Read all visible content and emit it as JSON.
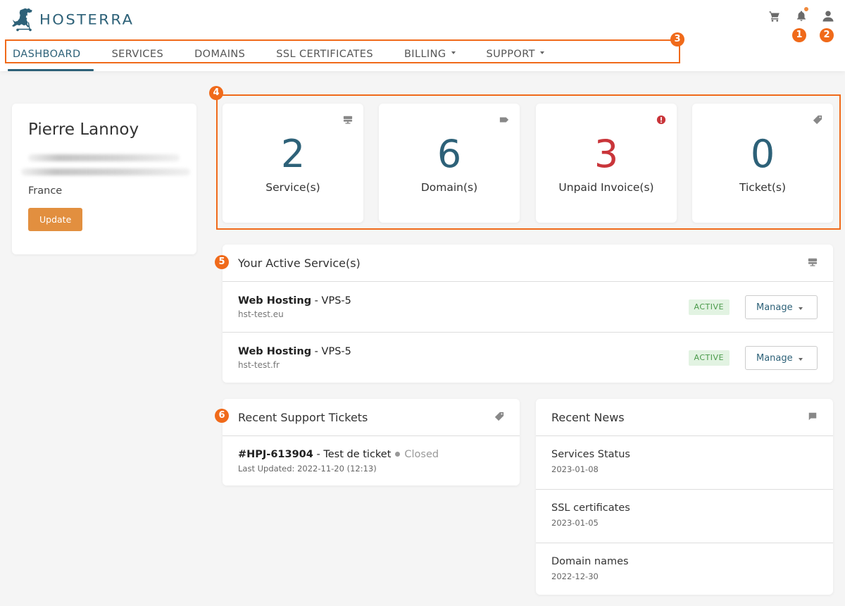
{
  "brand": {
    "name": "HOSTERRA",
    "color": "#2d6178"
  },
  "header": {
    "icons": [
      {
        "name": "cart-icon"
      },
      {
        "name": "bell-icon",
        "has_notification": true
      },
      {
        "name": "user-icon"
      }
    ]
  },
  "nav": {
    "items": [
      {
        "label": "DASHBOARD",
        "active": true
      },
      {
        "label": "SERVICES"
      },
      {
        "label": "DOMAINS"
      },
      {
        "label": "SSL CERTIFICATES"
      },
      {
        "label": "BILLING",
        "dropdown": true
      },
      {
        "label": "SUPPORT",
        "dropdown": true
      }
    ]
  },
  "annotations": [
    "1",
    "2",
    "3",
    "4",
    "5",
    "6"
  ],
  "profile": {
    "name": "Pierre Lannoy",
    "country": "France",
    "update_label": "Update"
  },
  "stats": [
    {
      "value": "2",
      "label": "Service(s)",
      "icon": "server-icon"
    },
    {
      "value": "6",
      "label": "Domain(s)",
      "icon": "tag-icon"
    },
    {
      "value": "3",
      "label": "Unpaid Invoice(s)",
      "icon": "alert-icon",
      "color": "#c9353a"
    },
    {
      "value": "0",
      "label": "Ticket(s)",
      "icon": "ticket-icon"
    }
  ],
  "services": {
    "title": "Your Active Service(s)",
    "items": [
      {
        "product": "Web Hosting",
        "plan": "VPS-5",
        "domain": "hst-test.eu",
        "status": "ACTIVE",
        "action": "Manage"
      },
      {
        "product": "Web Hosting",
        "plan": "VPS-5",
        "domain": "hst-test.fr",
        "status": "ACTIVE",
        "action": "Manage"
      }
    ]
  },
  "tickets": {
    "title": "Recent Support Tickets",
    "items": [
      {
        "id": "#HPJ-613904",
        "subject": "Test de ticket",
        "status": "Closed",
        "updated": "Last Updated: 2022-11-20 (12:13)"
      }
    ]
  },
  "news": {
    "title": "Recent News",
    "items": [
      {
        "title": "Services Status",
        "date": "2023-01-08"
      },
      {
        "title": "SSL certificates",
        "date": "2023-01-05"
      },
      {
        "title": "Domain names",
        "date": "2022-12-30"
      }
    ]
  },
  "separators": {
    "dash": " - "
  }
}
